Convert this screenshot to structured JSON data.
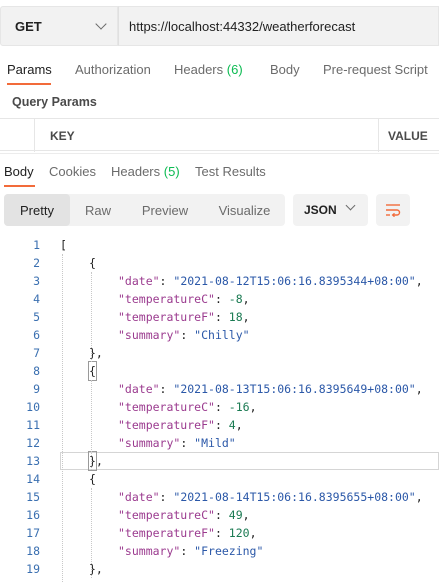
{
  "request": {
    "method": "GET",
    "url": "https://localhost:44332/weatherforecast"
  },
  "request_tabs": [
    {
      "label": "Params",
      "count": ""
    },
    {
      "label": "Authorization",
      "count": ""
    },
    {
      "label": "Headers",
      "count": "(6)"
    },
    {
      "label": "Body",
      "count": ""
    },
    {
      "label": "Pre-request Script",
      "count": ""
    }
  ],
  "query_params": {
    "title": "Query Params",
    "columns": [
      "KEY",
      "VALUE"
    ]
  },
  "response_tabs": [
    {
      "label": "Body",
      "count": ""
    },
    {
      "label": "Cookies",
      "count": ""
    },
    {
      "label": "Headers",
      "count": "(5)"
    },
    {
      "label": "Test Results",
      "count": ""
    }
  ],
  "view_modes": [
    "Pretty",
    "Raw",
    "Preview",
    "Visualize"
  ],
  "format": "JSON",
  "icons": {
    "method_dropdown": "chevron-down-icon",
    "format_dropdown": "chevron-down-icon",
    "wrap": "wrap-lines-icon"
  },
  "colors": {
    "accent": "#f26b3a",
    "count": "#0cbb52",
    "line_number": "#3a6fb0",
    "json_key": "#9b3b8f",
    "json_string": "#2b58a8",
    "json_number": "#1a7a52"
  },
  "code_lines": [
    {
      "n": "1",
      "indent": 0,
      "parts": [
        {
          "t": "p",
          "v": "["
        }
      ]
    },
    {
      "n": "2",
      "indent": 1,
      "parts": [
        {
          "t": "p",
          "v": "{"
        }
      ]
    },
    {
      "n": "3",
      "indent": 2,
      "parts": [
        {
          "t": "k",
          "v": "\"date\""
        },
        {
          "t": "p",
          "v": ": "
        },
        {
          "t": "s",
          "v": "\"2021-08-12T15:06:16.8395344+08:00\""
        },
        {
          "t": "p",
          "v": ","
        }
      ]
    },
    {
      "n": "4",
      "indent": 2,
      "parts": [
        {
          "t": "k",
          "v": "\"temperatureC\""
        },
        {
          "t": "p",
          "v": ": "
        },
        {
          "t": "n",
          "v": "-8"
        },
        {
          "t": "p",
          "v": ","
        }
      ]
    },
    {
      "n": "5",
      "indent": 2,
      "parts": [
        {
          "t": "k",
          "v": "\"temperatureF\""
        },
        {
          "t": "p",
          "v": ": "
        },
        {
          "t": "n",
          "v": "18"
        },
        {
          "t": "p",
          "v": ","
        }
      ]
    },
    {
      "n": "6",
      "indent": 2,
      "parts": [
        {
          "t": "k",
          "v": "\"summary\""
        },
        {
          "t": "p",
          "v": ": "
        },
        {
          "t": "s",
          "v": "\"Chilly\""
        }
      ]
    },
    {
      "n": "7",
      "indent": 1,
      "parts": [
        {
          "t": "p",
          "v": "},"
        }
      ]
    },
    {
      "n": "8",
      "indent": 1,
      "parts": [
        {
          "t": "b",
          "v": "{"
        }
      ]
    },
    {
      "n": "9",
      "indent": 2,
      "parts": [
        {
          "t": "k",
          "v": "\"date\""
        },
        {
          "t": "p",
          "v": ": "
        },
        {
          "t": "s",
          "v": "\"2021-08-13T15:06:16.8395649+08:00\""
        },
        {
          "t": "p",
          "v": ","
        }
      ]
    },
    {
      "n": "10",
      "indent": 2,
      "parts": [
        {
          "t": "k",
          "v": "\"temperatureC\""
        },
        {
          "t": "p",
          "v": ": "
        },
        {
          "t": "n",
          "v": "-16"
        },
        {
          "t": "p",
          "v": ","
        }
      ]
    },
    {
      "n": "11",
      "indent": 2,
      "parts": [
        {
          "t": "k",
          "v": "\"temperatureF\""
        },
        {
          "t": "p",
          "v": ": "
        },
        {
          "t": "n",
          "v": "4"
        },
        {
          "t": "p",
          "v": ","
        }
      ]
    },
    {
      "n": "12",
      "indent": 2,
      "parts": [
        {
          "t": "k",
          "v": "\"summary\""
        },
        {
          "t": "p",
          "v": ": "
        },
        {
          "t": "s",
          "v": "\"Mild\""
        }
      ]
    },
    {
      "n": "13",
      "indent": 1,
      "highlight": true,
      "parts": [
        {
          "t": "b",
          "v": "}"
        },
        {
          "t": "p",
          "v": ","
        }
      ]
    },
    {
      "n": "14",
      "indent": 1,
      "parts": [
        {
          "t": "p",
          "v": "{"
        }
      ]
    },
    {
      "n": "15",
      "indent": 2,
      "parts": [
        {
          "t": "k",
          "v": "\"date\""
        },
        {
          "t": "p",
          "v": ": "
        },
        {
          "t": "s",
          "v": "\"2021-08-14T15:06:16.8395655+08:00\""
        },
        {
          "t": "p",
          "v": ","
        }
      ]
    },
    {
      "n": "16",
      "indent": 2,
      "parts": [
        {
          "t": "k",
          "v": "\"temperatureC\""
        },
        {
          "t": "p",
          "v": ": "
        },
        {
          "t": "n",
          "v": "49"
        },
        {
          "t": "p",
          "v": ","
        }
      ]
    },
    {
      "n": "17",
      "indent": 2,
      "parts": [
        {
          "t": "k",
          "v": "\"temperatureF\""
        },
        {
          "t": "p",
          "v": ": "
        },
        {
          "t": "n",
          "v": "120"
        },
        {
          "t": "p",
          "v": ","
        }
      ]
    },
    {
      "n": "18",
      "indent": 2,
      "parts": [
        {
          "t": "k",
          "v": "\"summary\""
        },
        {
          "t": "p",
          "v": ": "
        },
        {
          "t": "s",
          "v": "\"Freezing\""
        }
      ]
    },
    {
      "n": "19",
      "indent": 1,
      "parts": [
        {
          "t": "p",
          "v": "},"
        }
      ]
    }
  ]
}
